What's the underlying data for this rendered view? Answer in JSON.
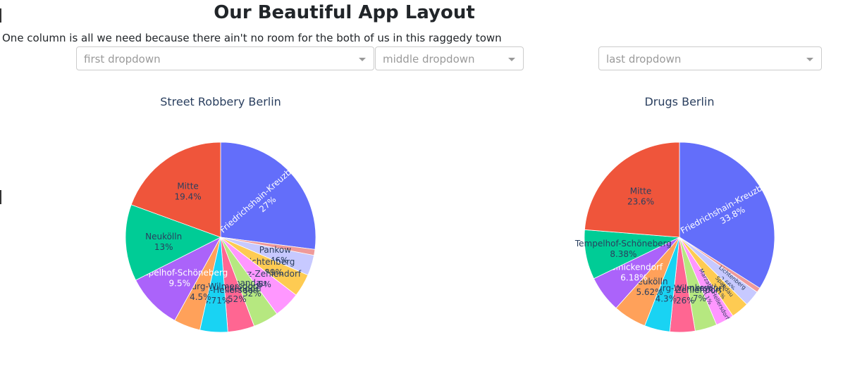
{
  "header": {
    "title": "Our Beautiful App Layout",
    "subtitle": "One column is all we need because there ain't no room for the both of us in this raggedy town"
  },
  "dropdowns": [
    {
      "placeholder": "first dropdown"
    },
    {
      "placeholder": "middle dropdown"
    },
    {
      "placeholder": "last dropdown"
    }
  ],
  "chart_data": [
    {
      "type": "pie",
      "title": "Street Robbery Berlin",
      "slices": [
        {
          "label": "Friedrichshain-Kreuzberg",
          "value": 27,
          "pct": "27%",
          "color": "#636efa"
        },
        {
          "label": "",
          "value": 1.0,
          "pct": "",
          "color": "#ef9a9a"
        },
        {
          "label": "Pankow",
          "value": 3.46,
          "pct": "3.46%",
          "color": "#c7c9ff"
        },
        {
          "label": "Lichtenberg",
          "value": 3.89,
          "pct": "3.89%",
          "color": "#fecb52"
        },
        {
          "label": "Steglitz-Zehlendorf",
          "value": 4.5,
          "pct": "4.5%",
          "color": "#ff97ff"
        },
        {
          "label": "Spandau",
          "value": 4.32,
          "pct": "4.32%",
          "color": "#b6e880"
        },
        {
          "label": "Reinickendorf",
          "value": 4.52,
          "pct": "4.52%",
          "color": "#ff6692"
        },
        {
          "label": "Marzahn-Hellersdorf",
          "value": 4.71,
          "pct": "4.71%",
          "color": "#19d3f3"
        },
        {
          "label": "Charlottenburg-Wilmersdorf",
          "value": 4.5,
          "pct": "4.5%",
          "color": "#ffa15a"
        },
        {
          "label": "Tempelhof-Schöneberg",
          "value": 9.5,
          "pct": "9.5%",
          "color": "#ab63fa"
        },
        {
          "label": "Neukölln",
          "value": 13,
          "pct": "13%",
          "color": "#00cc96"
        },
        {
          "label": "Mitte",
          "value": 19.4,
          "pct": "19.4%",
          "color": "#ef553b"
        }
      ]
    },
    {
      "type": "pie",
      "title": "Drugs Berlin",
      "slices": [
        {
          "label": "Friedrichshain-Kreuzberg",
          "value": 33.8,
          "pct": "33.8%",
          "color": "#636efa"
        },
        {
          "label": "",
          "value": 0.8,
          "pct": "",
          "color": "#ef9a9a"
        },
        {
          "label": "Lichtenberg",
          "value": 2.66,
          "pct": "2.66%",
          "color": "#c7c9ff"
        },
        {
          "label": "Spandau",
          "value": 3.01,
          "pct": "3.01%",
          "color": "#fecb52"
        },
        {
          "label": "Marzahn-Hellersdorf",
          "value": 3.1,
          "pct": "3.1%",
          "color": "#ff97ff"
        },
        {
          "label": "Pankow",
          "value": 3.7,
          "pct": "3.7%",
          "color": "#b6e880"
        },
        {
          "label": "Steglitz-Zehlendorf",
          "value": 4.26,
          "pct": "4.26%",
          "color": "#ff6692"
        },
        {
          "label": "Charlottenburg-Wilmersdorf",
          "value": 4.3,
          "pct": "4.3%",
          "color": "#19d3f3"
        },
        {
          "label": "Neukölln",
          "value": 5.62,
          "pct": "5.62%",
          "color": "#ffa15a"
        },
        {
          "label": "Reinickendorf",
          "value": 6.18,
          "pct": "6.18%",
          "color": "#ab63fa"
        },
        {
          "label": "Tempelhof-Schöneberg",
          "value": 8.38,
          "pct": "8.38%",
          "color": "#00cc96"
        },
        {
          "label": "Mitte",
          "value": 23.6,
          "pct": "23.6%",
          "color": "#ef553b"
        }
      ]
    }
  ]
}
